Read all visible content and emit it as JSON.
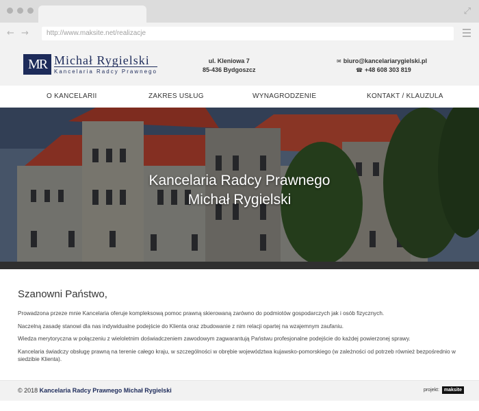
{
  "browser": {
    "url": "http://www.maksite.net/realizacje"
  },
  "header": {
    "logo_mark": "MR",
    "logo_name": "Michał Rygielski",
    "logo_sub": "Kancelaria Radcy Prawnego",
    "address_line1": "ul. Kleniowa 7",
    "address_line2": "85-436 Bydgoszcz",
    "email": "biuro@kancelariarygielski.pl",
    "phone": "+48 608 303 819"
  },
  "nav": {
    "items": [
      "O KANCELARII",
      "ZAKRES USŁUG",
      "WYNAGRODZENIE",
      "KONTAKT / KLAUZULA"
    ]
  },
  "hero": {
    "title_line1": "Kancelaria Radcy Prawnego",
    "title_line2": "Michał Rygielski"
  },
  "content": {
    "greeting": "Szanowni Państwo,",
    "paragraphs": [
      "Prowadzona przeze mnie Kancelaria oferuje kompleksową pomoc prawną skierowaną zarówno do podmiotów gospodarczych jak i osób fizycznych.",
      "Naczelną zasadę stanowi dla nas indywidualne podejście do Klienta oraz zbudowanie z nim relacji opartej na wzajemnym zaufaniu.",
      "Wiedza merytoryczna w połączeniu z wieloletnim doświadczeniem zawodowym zagwarantują Państwu profesjonalne podejście do każdej powierzonej sprawy.",
      "Kancelaria świadczy obsługę prawną na terenie całego kraju, w szczególności w obrębie województwa kujawsko-pomorskiego (w zależności od potrzeb również bezpośrednio w siedzibie Klienta)."
    ]
  },
  "footer": {
    "copyright": "© 2018",
    "company": "Kancelaria Radcy Prawnego Michał Rygielski",
    "credit_label": "projekt:",
    "credit_brand": "maksite"
  },
  "colors": {
    "brand": "#1d2b5a",
    "header_bg": "#f2f2f2",
    "chrome_bg": "#dcdcdc"
  },
  "icons": [
    "arrow-left-icon",
    "arrow-right-icon",
    "expand-icon",
    "menu-icon",
    "envelope-icon",
    "phone-icon"
  ]
}
